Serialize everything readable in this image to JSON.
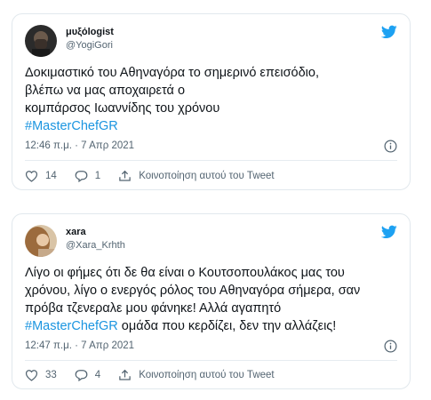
{
  "tweets": [
    {
      "author": {
        "name": "μυξόlogist",
        "handle": "@YogiGori"
      },
      "text_lines": [
        "Δοκιμαστικό του Αθηναγόρα το σημερινό επεισόδιο,",
        "βλέπω να μας αποχαιρετά ο",
        "κομπάρσος Ιωαννίδης του χρόνου"
      ],
      "hashtag": "#MasterChefGR",
      "timestamp": "12:46 π.μ. · 7 Απρ 2021",
      "likes": "14",
      "replies": "1",
      "share_label": "Κοινοποίηση αυτού του Tweet"
    },
    {
      "author": {
        "name": "xara",
        "handle": "@Xara_Krhth"
      },
      "text_lines": [
        "Λίγο οι φήμες ότι δε θα είναι ο Κουτσοπουλάκος μας του",
        "χρόνου, λίγο ο ενεργός ρόλος του Αθηναγόρα σήμερα, σαν",
        "πρόβα τζενεραλε μου φάνηκε! Αλλά αγαπητό"
      ],
      "hashtag": "#MasterChefGR",
      "hashtag_trailing": " ομάδα που κερδίζει, δεν την αλλάζεις!",
      "timestamp": "12:47 π.μ. · 7 Απρ 2021",
      "likes": "33",
      "replies": "4",
      "share_label": "Κοινοποίηση αυτού του Tweet"
    }
  ],
  "colors": {
    "accent": "#1b95e0",
    "muted": "#536471",
    "like": "#536471"
  },
  "icons": [
    "twitter-bird-icon",
    "info-icon",
    "heart-icon",
    "reply-icon",
    "share-icon"
  ]
}
